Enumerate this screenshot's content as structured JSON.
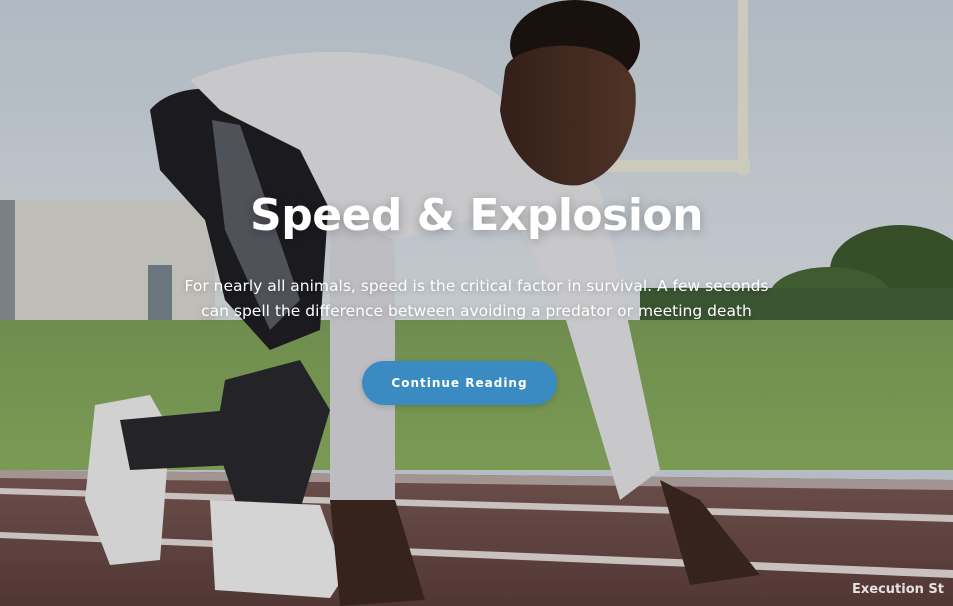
{
  "hero": {
    "title": "Speed & Explosion",
    "subtitle": "For nearly all animals, speed is the critical factor in survival. A few seconds can spell the difference between avoiding a predator or meeting death",
    "cta_label": "Continue Reading",
    "watermark": "Execution St",
    "accent_color": "#3a8bc1",
    "image_subject": "sprinter-in-starting-position"
  }
}
